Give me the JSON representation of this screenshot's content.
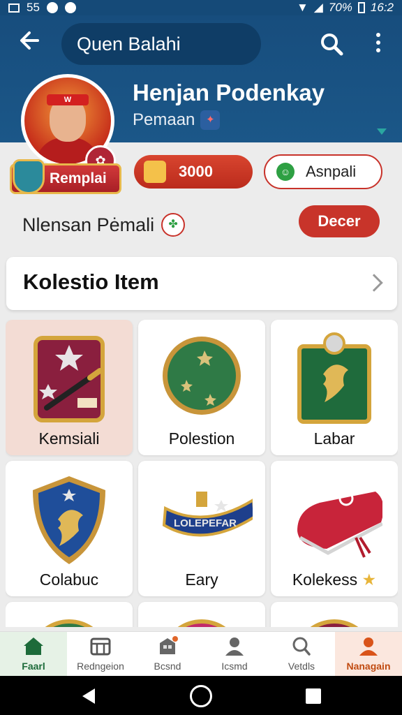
{
  "status_bar": {
    "left": "55",
    "battery": "70%",
    "time": "16:2"
  },
  "app_bar": {
    "search_text": "Quen Balahi",
    "back_icon": "arrow-left-icon",
    "search_icon": "search-icon",
    "more_icon": "more-vert-icon"
  },
  "profile": {
    "name": "Henjan Podenkay",
    "role": "Pemaan",
    "rank_label": "Remplai",
    "coins": "3000",
    "friend_label": "Asnpali",
    "status_text": "Nlensan Pėmali",
    "status_button": "Decer"
  },
  "collection": {
    "title": "Kolestio Item",
    "items": [
      {
        "label": "Kemsiali",
        "selected": true,
        "icon": "banner-pen-icon"
      },
      {
        "label": "Polestion",
        "selected": false,
        "icon": "green-orb-icon"
      },
      {
        "label": "Labar",
        "selected": false,
        "icon": "lion-frame-icon"
      },
      {
        "label": "Colabuc",
        "selected": false,
        "icon": "lion-shield-icon"
      },
      {
        "label": "Eary",
        "selected": false,
        "icon": "blue-collar-icon",
        "art_text": "LOLEPEFAR"
      },
      {
        "label": "Kolekess",
        "selected": false,
        "icon": "red-case-icon",
        "star": "★"
      },
      {
        "label": "",
        "selected": false,
        "icon": "partial-item-icon"
      },
      {
        "label": "",
        "selected": false,
        "icon": "partial-item-icon"
      },
      {
        "label": "",
        "selected": false,
        "icon": "partial-item-icon"
      }
    ]
  },
  "bottom_nav": [
    {
      "label": "Faarl",
      "icon": "home-icon"
    },
    {
      "label": "Redngeion",
      "icon": "store-icon"
    },
    {
      "label": "Bcsnd",
      "icon": "shop-icon"
    },
    {
      "label": "Icsmd",
      "icon": "person-icon"
    },
    {
      "label": "Vetdls",
      "icon": "search-icon"
    },
    {
      "label": "Nanagain",
      "icon": "profile-icon"
    }
  ],
  "colors": {
    "appbar": "#174d7d",
    "accent_red": "#c8342a",
    "home_green": "#1d6b3a"
  }
}
